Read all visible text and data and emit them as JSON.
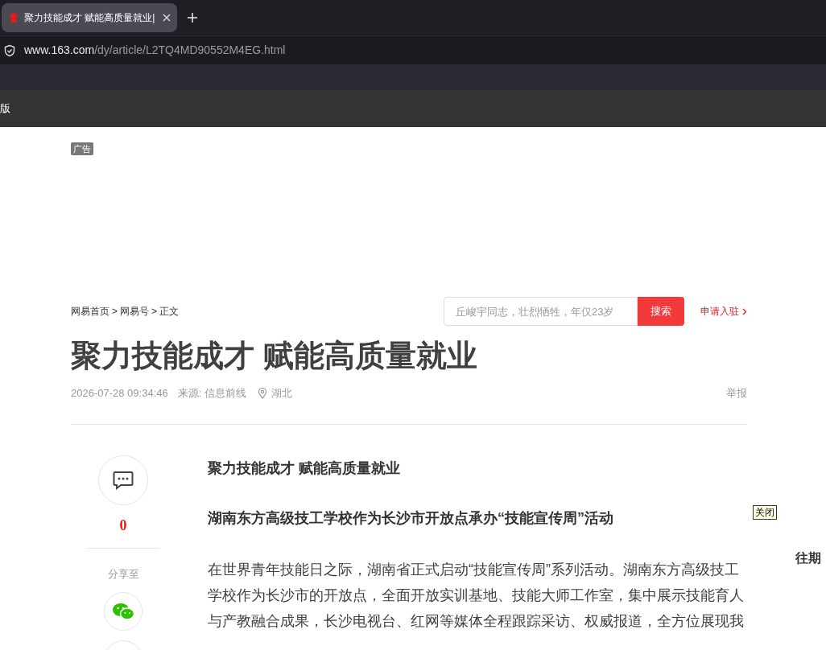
{
  "browser": {
    "tab": {
      "title": "聚力技能成才 赋能高质量就业|",
      "selected": true
    },
    "url": {
      "host": "www.163.com",
      "path": "/dy/article/L2TQ4MD90552M4EG.html"
    },
    "bookmark_bar": {
      "item": "版"
    }
  },
  "ad": {
    "label": "广告"
  },
  "breadcrumb": [
    "网易首页",
    ">",
    "网易号",
    ">",
    "正文"
  ],
  "search": {
    "placeholder": "丘峻宇同志，壮烈牺牲，年仅23岁",
    "button": "搜索"
  },
  "apply_link": "申请入驻",
  "article": {
    "title": "聚力技能成才 赋能高质量就业",
    "date": "2026-07-28 09:34:46",
    "source": "来源: 信息前线",
    "location": "湖北",
    "report": "举报",
    "paragraphs": [
      {
        "kind": "heading",
        "text": "聚力技能成才 赋能高质量就业"
      },
      {
        "kind": "heading",
        "text": "湖南东方高级技工学校作为长沙市开放点承办“技能宣传周”活动"
      },
      {
        "kind": "body",
        "text": "在世界青年技能日之际，湖南省正式启动“技能宣传周”系列活动。湖南东方高级技工学校作为长沙市的开放点，全面开放实训基地、技能大师工作室，集中展示技能育人与产教融合成果，长沙电视台、红网等媒体全程跟踪采访、权威报道，全方位展现我"
      }
    ]
  },
  "side": {
    "comment_count": "0",
    "share_label": "分享至"
  },
  "close_label": "关闭",
  "right_heading": "往期"
}
